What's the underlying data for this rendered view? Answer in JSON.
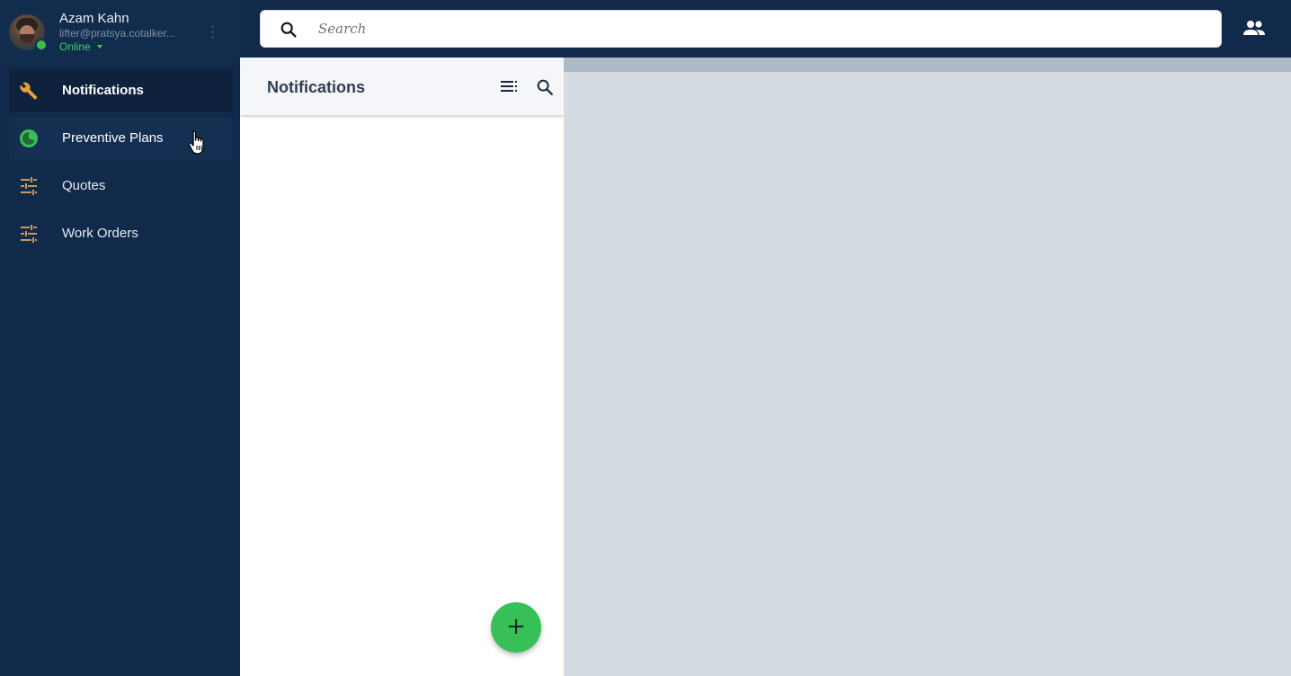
{
  "user": {
    "name": "Azam Kahn",
    "email": "lifter@pratsya.cotalker...",
    "status": "Online"
  },
  "search": {
    "placeholder": "Search"
  },
  "sidebar": {
    "items": [
      {
        "label": "Notifications",
        "icon": "wrench-icon",
        "active": true
      },
      {
        "label": "Preventive Plans",
        "icon": "timer-icon",
        "active": false
      },
      {
        "label": "Quotes",
        "icon": "sliders-icon",
        "active": false
      },
      {
        "label": "Work Orders",
        "icon": "sliders-icon",
        "active": false
      }
    ]
  },
  "panel": {
    "title": "Notifications",
    "fab_label": "+"
  },
  "colors": {
    "sidebar_bg": "#11294a",
    "accent_green": "#37c057",
    "icon_orange": "#e8a03a",
    "status_green": "#3ad35a"
  }
}
